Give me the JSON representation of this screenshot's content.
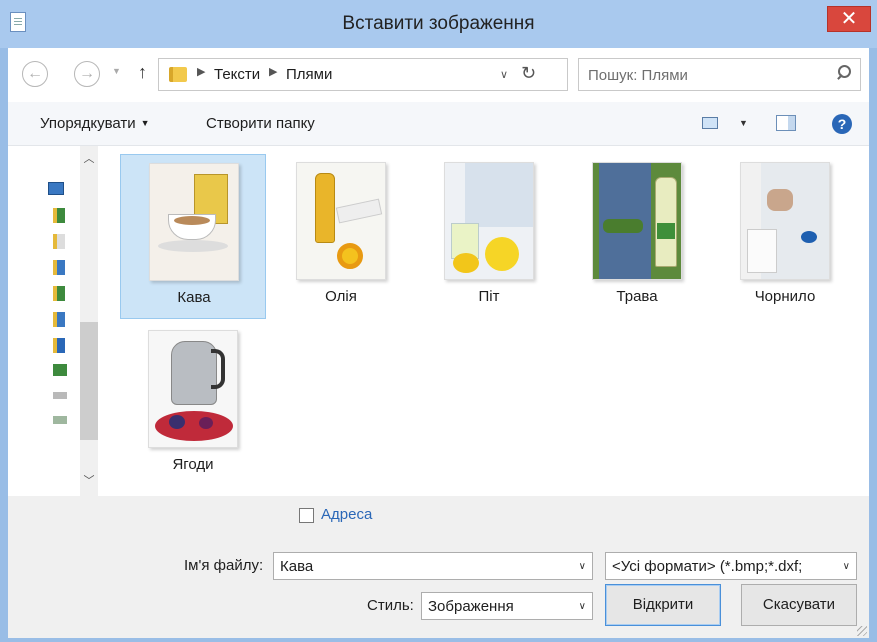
{
  "window": {
    "title": "Вставити зображення",
    "close_glyph": "✕"
  },
  "address": {
    "breadcrumb": [
      "Тексти",
      "Плями"
    ],
    "search_placeholder": "Пошук: Плями"
  },
  "toolbar": {
    "organize_label": "Упорядкувати",
    "new_folder_label": "Створити папку",
    "help_glyph": "?"
  },
  "files": [
    {
      "name": "Кава",
      "selected": true,
      "icon": "coffee-soda-thumbnail"
    },
    {
      "name": "Олія",
      "selected": false,
      "icon": "oil-bottle-thumbnail"
    },
    {
      "name": "Піт",
      "selected": false,
      "icon": "sweat-lemon-thumbnail"
    },
    {
      "name": "Трава",
      "selected": false,
      "icon": "grass-jeans-thumbnail"
    },
    {
      "name": "Чорнило",
      "selected": false,
      "icon": "ink-milk-thumbnail"
    },
    {
      "name": "Ягоди",
      "selected": false,
      "icon": "kettle-berries-thumbnail"
    }
  ],
  "bottom": {
    "address_checkbox_label": "Адреса",
    "filename_label": "Ім'я файлу:",
    "filename_value": "Кава",
    "filter_value": "<Усі формати> (*.bmp;*.dxf;",
    "style_label": "Стиль:",
    "style_value": "Зображення",
    "open_button": "Відкрити",
    "cancel_button": "Скасувати"
  },
  "colors": {
    "title_bar": "#a9c9ee",
    "close_button": "#d9473d",
    "selection": "#cce4f7",
    "link_blue": "#2a67b7"
  }
}
